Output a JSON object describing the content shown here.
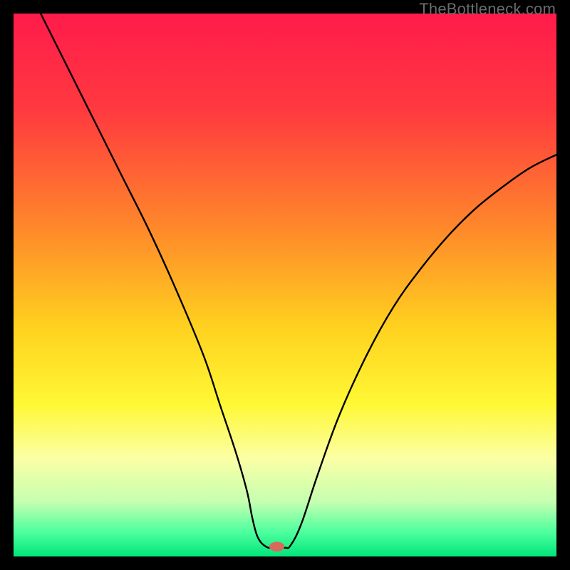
{
  "watermark": "TheBottleneck.com",
  "chart_data": {
    "type": "line",
    "title": "",
    "xlabel": "",
    "ylabel": "",
    "xlim": [
      0,
      100
    ],
    "ylim": [
      0,
      100
    ],
    "background_gradient_stops": [
      {
        "offset": 0.0,
        "color": "#ff1b4b"
      },
      {
        "offset": 0.18,
        "color": "#ff3a3f"
      },
      {
        "offset": 0.4,
        "color": "#ff8a2a"
      },
      {
        "offset": 0.58,
        "color": "#ffd21f"
      },
      {
        "offset": 0.72,
        "color": "#fff835"
      },
      {
        "offset": 0.82,
        "color": "#fbffa6"
      },
      {
        "offset": 0.9,
        "color": "#c4ffb0"
      },
      {
        "offset": 0.955,
        "color": "#4eff9e"
      },
      {
        "offset": 1.0,
        "color": "#00e67a"
      }
    ],
    "curve": {
      "x": [
        5,
        10,
        15,
        20,
        25,
        30,
        35,
        38,
        41,
        43,
        44,
        45,
        46.5,
        48,
        50,
        51,
        53,
        56,
        60,
        65,
        70,
        75,
        80,
        85,
        90,
        95,
        100
      ],
      "y": [
        100,
        90,
        80,
        70,
        60,
        49,
        37,
        28,
        19,
        12,
        7,
        3.5,
        1.8,
        1.6,
        1.6,
        2.0,
        6,
        15,
        26,
        37,
        46,
        53,
        59,
        64,
        68,
        71.5,
        74
      ]
    },
    "valley_flat": {
      "x_start": 45.5,
      "x_end": 50.5,
      "y": 1.8
    },
    "marker": {
      "x": 48.5,
      "y": 1.8,
      "rx": 1.4,
      "ry": 0.9,
      "color": "#d86a5c"
    }
  }
}
